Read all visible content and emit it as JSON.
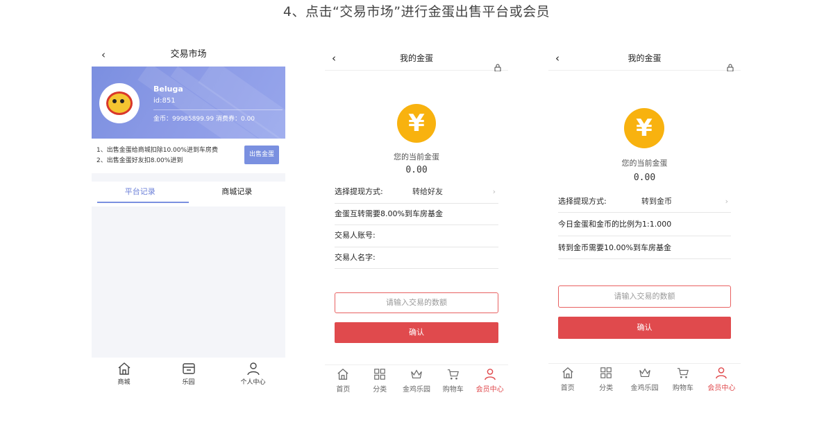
{
  "page_title": "4、点击“交易市场”进行金蛋出售平台或会员",
  "market": {
    "title": "交易市场",
    "back_icon": "chevron-left-icon",
    "user": {
      "name": "Beluga",
      "id": "id:851",
      "coins": "金币：99985899.99   消费券：0.00"
    },
    "notes": [
      "1、出售金蛋给商城扣除10.00%进到车房费",
      "2、出售金蛋好友扣8.00%进到"
    ],
    "sell_button": "出售金蛋",
    "tabs": [
      {
        "label": "平台记录",
        "active": true
      },
      {
        "label": "商城记录",
        "active": false
      }
    ],
    "nav": [
      {
        "label": "商城",
        "icon": "home-icon"
      },
      {
        "label": "乐园",
        "icon": "shop-icon"
      },
      {
        "label": "个人中心",
        "icon": "user-icon"
      }
    ]
  },
  "egg_friend": {
    "title": "我的金蛋",
    "coin_symbol": "¥",
    "current_label": "您的当前金蛋",
    "amount": "0.00",
    "method_label": "选择提现方式:",
    "method_value": "转给好友",
    "info": "金蛋互转需要8.00%到车房基金",
    "account_label": "交易人账号:",
    "name_label": "交易人名字:",
    "input_placeholder": "请输入交易的数额",
    "confirm": "确认"
  },
  "egg_coin": {
    "title": "我的金蛋",
    "coin_symbol": "¥",
    "current_label": "您的当前金蛋",
    "amount": "0.00",
    "method_label": "选择提现方式:",
    "method_value": "转到金币",
    "ratio": "今日金蛋和金币的比例为1:1.000",
    "info": "转到金币需要10.00%到车房基金",
    "input_placeholder": "请输入交易的数额",
    "confirm": "确认"
  },
  "bottom_nav": [
    {
      "label": "首页",
      "icon": "home-icon",
      "active": false
    },
    {
      "label": "分类",
      "icon": "grid-icon",
      "active": false
    },
    {
      "label": "金鸡乐园",
      "icon": "crown-icon",
      "active": false
    },
    {
      "label": "购物车",
      "icon": "cart-icon",
      "active": false
    },
    {
      "label": "会员中心",
      "icon": "user-icon",
      "active": true
    }
  ],
  "colors": {
    "accent_blue": "#7a90e0",
    "accent_red": "#e04a4d",
    "coin_gold": "#f8b20f"
  }
}
